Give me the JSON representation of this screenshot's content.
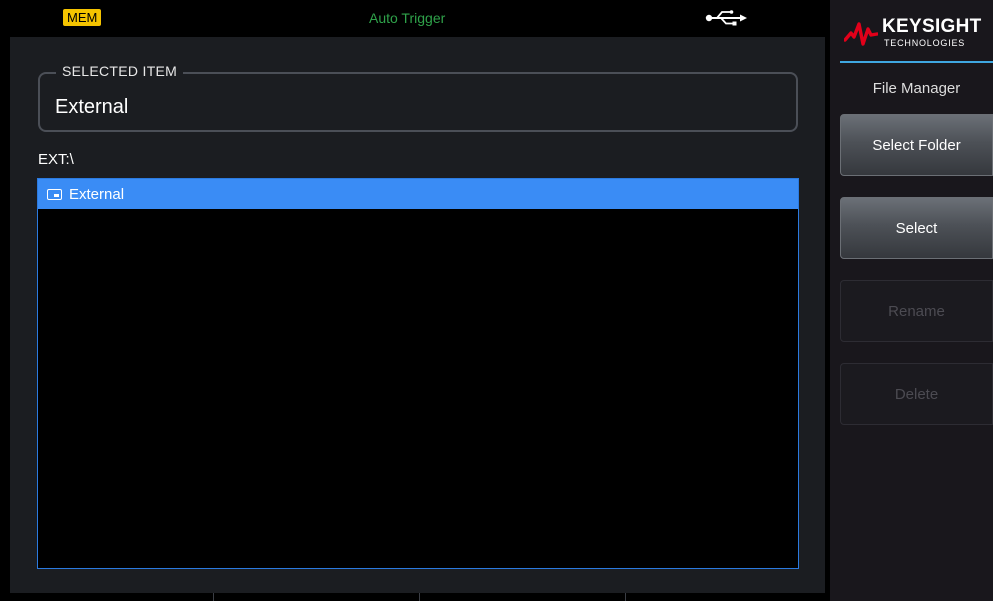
{
  "status": {
    "mem_badge": "MEM",
    "trigger": "Auto Trigger",
    "usb_icon": "usb-icon"
  },
  "selected_item": {
    "legend": "SELECTED ITEM",
    "value": "External"
  },
  "path": "EXT:\\",
  "file_list": [
    {
      "name": "External",
      "icon": "drive-icon",
      "selected": true
    }
  ],
  "brand": {
    "name": "KEYSIGHT",
    "sub": "TECHNOLOGIES"
  },
  "softkeys": {
    "title": "File Manager",
    "items": [
      {
        "label": "Select Folder",
        "enabled": true
      },
      {
        "label": "Select",
        "enabled": true
      },
      {
        "label": "Rename",
        "enabled": false
      },
      {
        "label": "Delete",
        "enabled": false
      }
    ]
  },
  "colors": {
    "mem_badge": "#f5c400",
    "trigger_text": "#2fa24a",
    "selection": "#3a8cf5",
    "accent": "#3fa7e0",
    "logo_red": "#e2001a"
  }
}
